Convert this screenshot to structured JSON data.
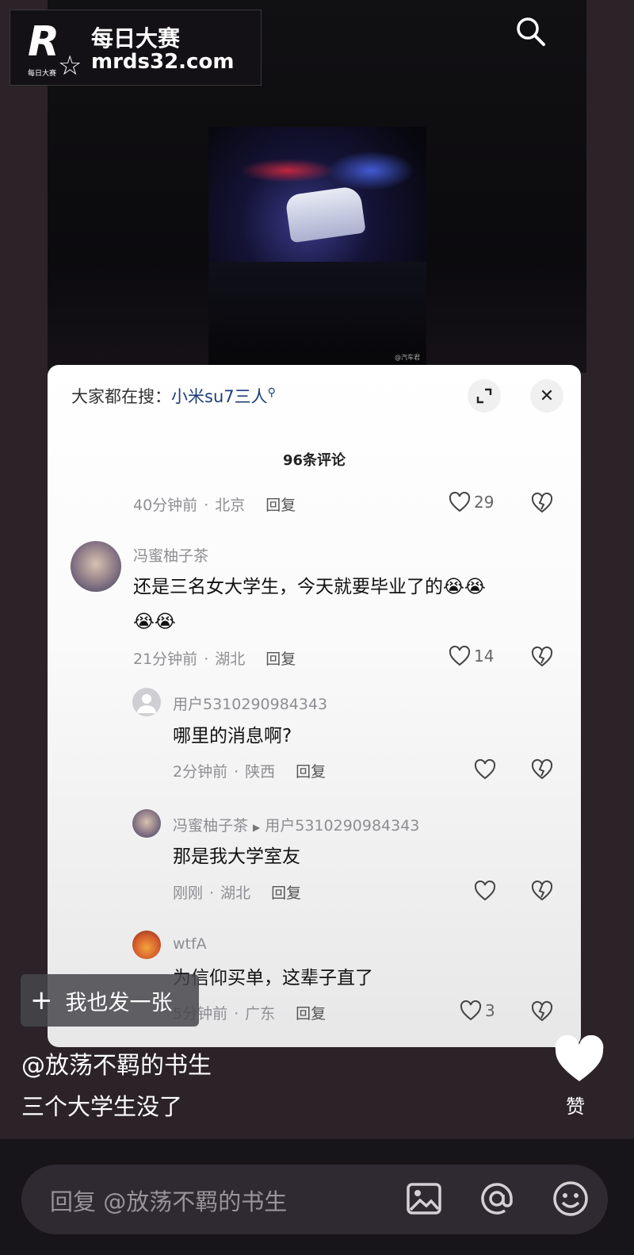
{
  "logo": {
    "mark": "R",
    "mark_sub": "每日大赛",
    "name": "每日大赛",
    "domain": "mrds32.com"
  },
  "video": {
    "watermark": "@汽车君"
  },
  "sheet": {
    "search_prefix": "大家都在搜：",
    "search_term": "小米su7三人",
    "comment_count": "96条评论",
    "comments": [
      {
        "time": "40分钟前",
        "location": "北京",
        "reply": "回复",
        "likes": "29"
      },
      {
        "user": "冯蜜柚子茶",
        "text_line1": "还是三名女大学生，今天就要毕业了的😭😭",
        "text_line2": "😭😭",
        "time": "21分钟前",
        "location": "湖北",
        "reply": "回复",
        "likes": "14",
        "replies": [
          {
            "user": "用户5310290984343",
            "text": "哪里的消息啊?",
            "time": "2分钟前",
            "location": "陕西",
            "reply": "回复"
          },
          {
            "user": "冯蜜柚子茶",
            "reply_to": "用户5310290984343",
            "text": "那是我大学室友",
            "time": "刚刚",
            "location": "湖北",
            "reply": "回复"
          },
          {
            "user": "wtfA",
            "text": "为信仰买单，这辈子直了",
            "time": "5分钟前",
            "location": "广东",
            "reply": "回复",
            "likes": "3"
          }
        ]
      }
    ]
  },
  "post": {
    "post_button": "我也发一张",
    "author": "@放荡不羁的书生",
    "caption": "三个大学生没了",
    "like_label": "赞"
  },
  "input": {
    "placeholder": "回复 @放荡不羁的书生"
  },
  "colors": {
    "background": "#2b2328",
    "sheet": "#ffffff",
    "search_term": "#1c3f78"
  }
}
